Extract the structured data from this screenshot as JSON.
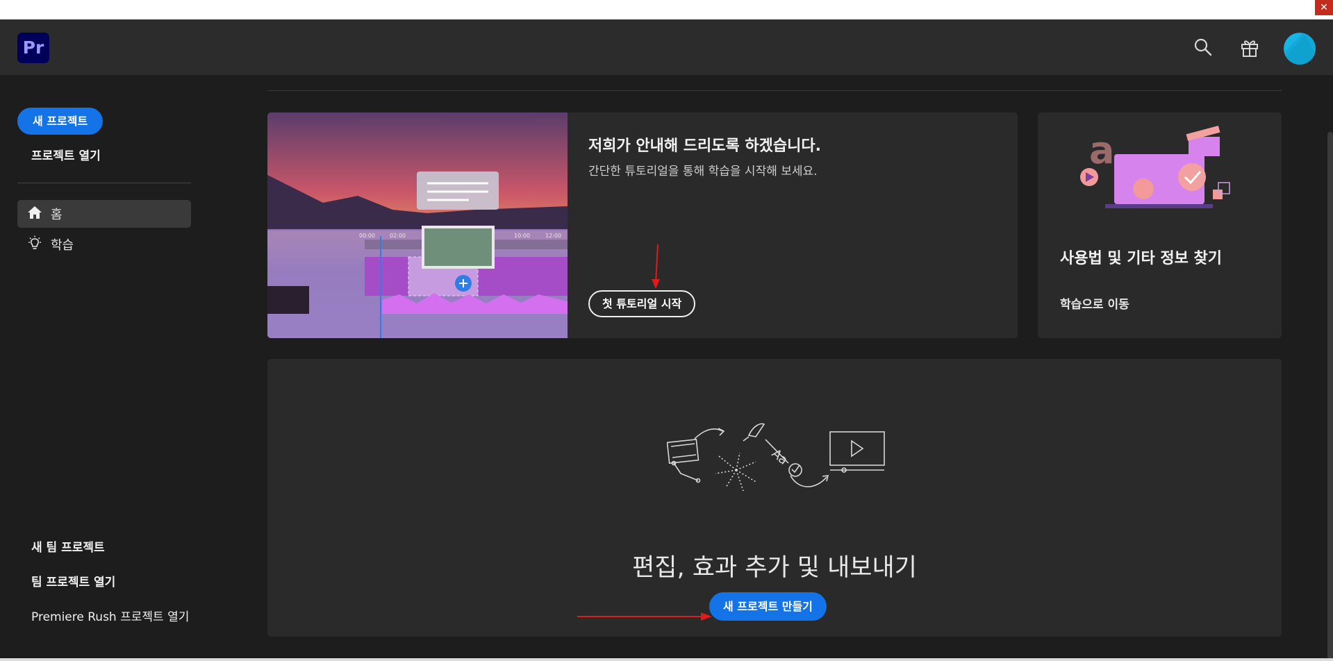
{
  "window": {
    "close_glyph": "✕"
  },
  "header": {
    "logo_text": "Pr",
    "icons": [
      "search-icon",
      "gift-icon",
      "avatar"
    ]
  },
  "sidebar": {
    "new_project": "새 프로젝트",
    "open_project": "프로젝트 열기",
    "nav": [
      {
        "label": "홈",
        "icon": "home-icon",
        "active": true
      },
      {
        "label": "학습",
        "icon": "lightbulb-icon",
        "active": false
      }
    ],
    "new_team_project": "새 팀 프로젝트",
    "open_team_project": "팀 프로젝트 열기",
    "open_rush_project": "Premiere Rush 프로젝트 열기"
  },
  "tutorial_card": {
    "title": "저희가 안내해 드리도록 하겠습니다.",
    "subtitle": "간단한 튜토리얼을 통해 학습을 시작해 보세요.",
    "button": "첫 튜토리얼 시작",
    "timeline_ticks": [
      "00:00",
      "02:00",
      "10:00",
      "12:00"
    ]
  },
  "learn_card": {
    "title": "사용법 및 기타 정보 찾기",
    "link": "학습으로 이동"
  },
  "create_card": {
    "title": "편집, 효과 추가 및 내보내기",
    "button": "새 프로젝트 만들기"
  },
  "colors": {
    "accent": "#1473e6",
    "background": "#1d1d1d",
    "card": "#2a2a2a",
    "header": "#2c2c2c",
    "annotation_arrow": "#e01b1b"
  }
}
